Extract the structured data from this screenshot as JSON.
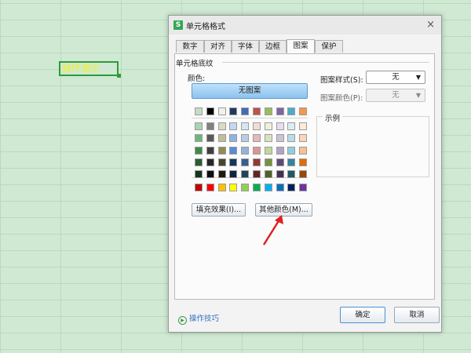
{
  "sheet": {
    "cell_text": "操作演示"
  },
  "dialog": {
    "title": "单元格格式",
    "icon_glyph": "S",
    "tabs": [
      {
        "label": "数字"
      },
      {
        "label": "对齐"
      },
      {
        "label": "字体"
      },
      {
        "label": "边框"
      },
      {
        "label": "图案",
        "active": true
      },
      {
        "label": "保护"
      }
    ],
    "group_label": "单元格底纹",
    "color_label": "颜色:",
    "no_pattern_label": "无图案",
    "palette_row_top": [
      "#c7dcc4",
      "#000000",
      "#f0f0f0",
      "#1f3a5f",
      "#3f6eb5",
      "#c0504d",
      "#9bbb59",
      "#8064a2",
      "#4bacc6",
      "#f79646"
    ],
    "palette_grid": [
      [
        "#a9d5ad",
        "#808080",
        "#ddd9c3",
        "#c6d9f0",
        "#dbe5f1",
        "#f2dcdb",
        "#ebf1dd",
        "#e5e0ec",
        "#dbeef3",
        "#fdeada"
      ],
      [
        "#6fb779",
        "#595959",
        "#c4bd97",
        "#8db3e2",
        "#b8cce4",
        "#e5b9b7",
        "#d7e3bc",
        "#ccc1d9",
        "#b7dde8",
        "#fbd5b5"
      ],
      [
        "#3d8a4a",
        "#3f3f3f",
        "#938953",
        "#548dd4",
        "#95b3d7",
        "#d99694",
        "#c3d69b",
        "#b2a2c7",
        "#92cddc",
        "#fac08f"
      ],
      [
        "#285d31",
        "#262626",
        "#494429",
        "#17365d",
        "#366092",
        "#953734",
        "#76923c",
        "#5f497a",
        "#31859b",
        "#e36c09"
      ],
      [
        "#12361a",
        "#0c0c0c",
        "#1d1b10",
        "#0f243e",
        "#244061",
        "#632423",
        "#4f6128",
        "#3f3151",
        "#205867",
        "#974806"
      ]
    ],
    "palette_standard": [
      "#c00000",
      "#ff0000",
      "#ffc000",
      "#ffff00",
      "#92d050",
      "#00b050",
      "#00b0f0",
      "#0070c0",
      "#002060",
      "#7030a0"
    ],
    "fill_effects_label": "填充效果(I)...",
    "more_colors_label": "其他颜色(M)...",
    "pattern_style_label": "图案样式(S):",
    "pattern_style_value": "无",
    "pattern_color_label": "图案颜色(P):",
    "pattern_color_value": "无",
    "sample_label": "示例",
    "tips_label": "操作技巧",
    "ok_label": "确定",
    "cancel_label": "取消",
    "close_glyph": "×"
  },
  "annotation": {
    "arrow_color": "#e02020"
  }
}
